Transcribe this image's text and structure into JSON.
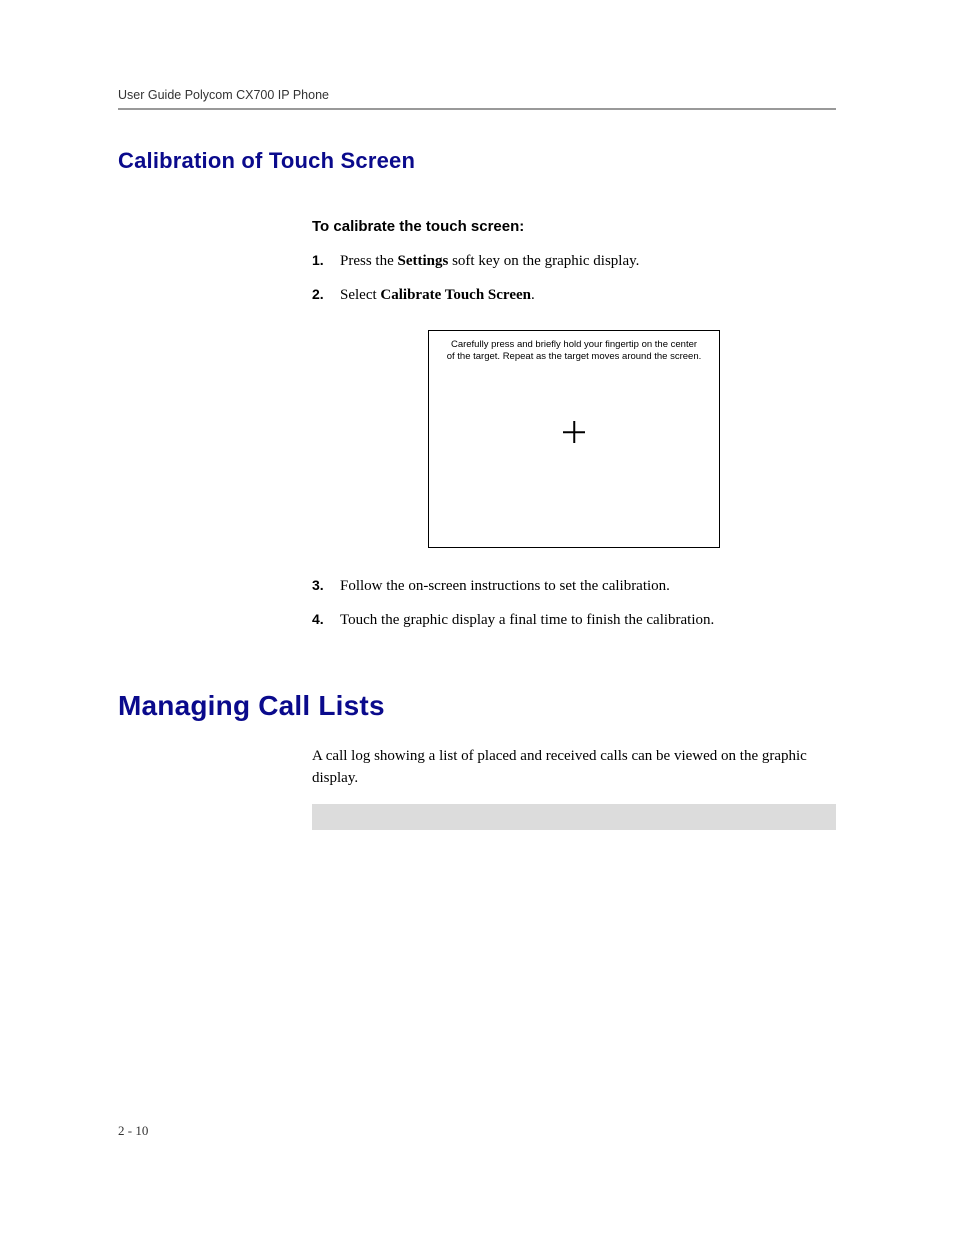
{
  "header": {
    "running_title": "User Guide Polycom CX700 IP Phone"
  },
  "section1": {
    "title": "Calibration of Touch Screen",
    "procedure_title": "To calibrate the touch screen:",
    "steps": [
      {
        "n": "1.",
        "pre": "Press the ",
        "bold": "Settings",
        "post": " soft key on the graphic display."
      },
      {
        "n": "2.",
        "pre": "Select ",
        "bold": "Calibrate Touch Screen",
        "post": "."
      },
      {
        "n": "3.",
        "pre": "Follow the on-screen instructions to set the calibration.",
        "bold": "",
        "post": ""
      },
      {
        "n": "4.",
        "pre": "Touch the graphic display a final time to finish the calibration.",
        "bold": "",
        "post": ""
      }
    ],
    "screenshot": {
      "line1": "Carefully press and briefly hold your fingertip on the center",
      "line2": "of the target. Repeat as the target moves around the screen."
    }
  },
  "section2": {
    "title": "Managing Call Lists",
    "para": "A call log showing a list of placed and received calls can be viewed on the graphic display."
  },
  "footer": {
    "page": "2 - 10"
  }
}
